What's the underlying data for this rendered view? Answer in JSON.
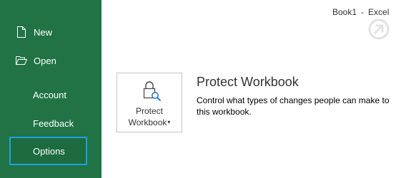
{
  "window": {
    "document_name": "Book1",
    "separator": "-",
    "app_name": "Excel"
  },
  "sidebar": {
    "background": "#217346",
    "items": [
      {
        "label": "New",
        "icon": "new-document-icon"
      },
      {
        "label": "Open",
        "icon": "folder-open-icon"
      },
      {
        "label": "Account"
      },
      {
        "label": "Feedback"
      },
      {
        "label": "Options",
        "highlighted": true,
        "highlight_color": "#1ea1e1"
      }
    ]
  },
  "protect": {
    "button_line1": "Protect",
    "button_line2": "Workbook",
    "caret": "▾",
    "icon": "lock-search-icon",
    "title": "Protect Workbook",
    "description": "Control what types of changes people can make to this workbook."
  }
}
